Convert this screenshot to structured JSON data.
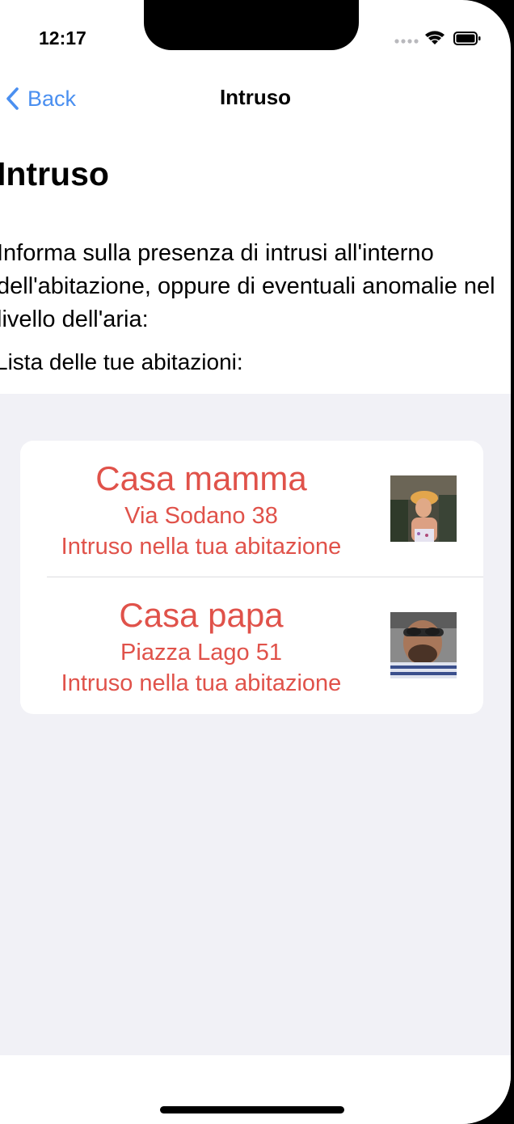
{
  "status_bar": {
    "time": "12:17",
    "icons": [
      "signal-dots-icon",
      "wifi-icon",
      "battery-icon"
    ]
  },
  "navbar": {
    "back_label": "Back",
    "title": "Intruso"
  },
  "page": {
    "large_title": "Intruso",
    "description": "Informa sulla presenza di intrusi all'interno dell'abitazione, oppure di eventuali anomalie nel livello dell'aria:",
    "list_caption": "Lista delle tue abitazioni:"
  },
  "homes": [
    {
      "name": "Casa mamma",
      "address": "Via Sodano 38",
      "status": "Intruso nella tua abitazione"
    },
    {
      "name": "Casa papa",
      "address": "Piazza Lago 51",
      "status": "Intruso nella tua abitazione"
    }
  ],
  "colors": {
    "accent_blue": "#4a8ff0",
    "alert_red": "#e0524a",
    "grouped_background": "#f1f1f6"
  }
}
